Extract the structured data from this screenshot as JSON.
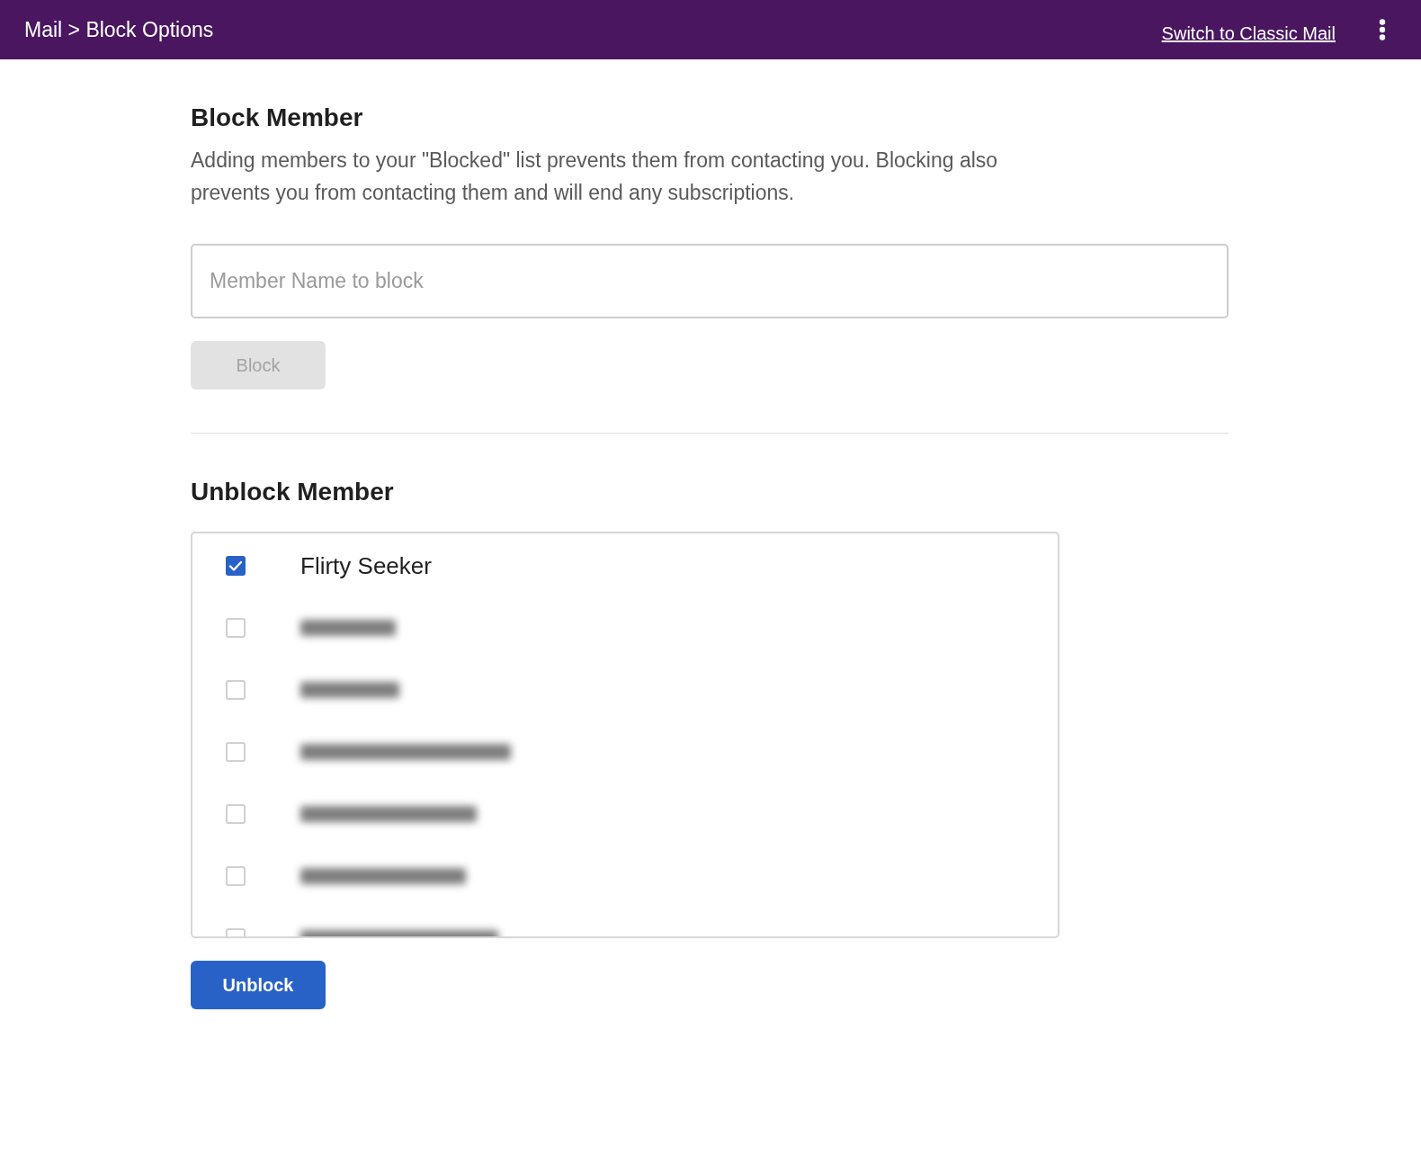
{
  "header": {
    "breadcrumb": "Mail > Block Options",
    "link": "Switch to Classic Mail"
  },
  "block_section": {
    "title": "Block Member",
    "description": "Adding members to your \"Blocked\" list prevents them from contacting you. Blocking also prevents you from contacting them and will end any subscriptions.",
    "input": {
      "placeholder": "Member Name to block"
    },
    "button": {
      "label": "Block",
      "disabled": true
    }
  },
  "unblock_section": {
    "title": "Unblock Member",
    "members": [
      {
        "kind": "visible",
        "name": "Flirty Seeker",
        "checked": true
      },
      {
        "kind": "blurred",
        "checked": false
      },
      {
        "kind": "blurred",
        "checked": false
      },
      {
        "kind": "blurred",
        "checked": false
      },
      {
        "kind": "blurred",
        "checked": false
      },
      {
        "kind": "blurred",
        "checked": false
      },
      {
        "kind": "blurred",
        "checked": false
      }
    ],
    "button": {
      "label": "Unblock",
      "disabled": false
    }
  }
}
